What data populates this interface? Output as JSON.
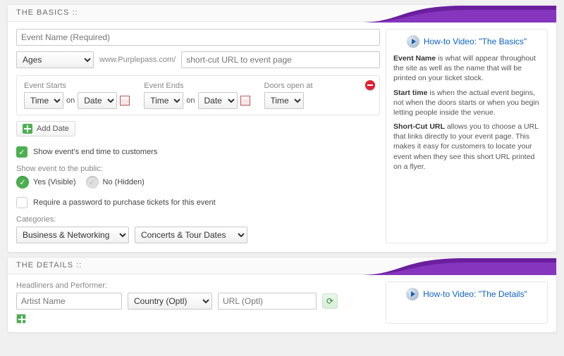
{
  "basics": {
    "header": "THE BASICS ::",
    "event_name_placeholder": "Event Name (Required)",
    "ages_value": "Ages",
    "url_prefix": "www.Purplepass.com/",
    "url_placeholder": "short-cut URL to event page",
    "date_box": {
      "event_starts_label": "Event Starts",
      "event_ends_label": "Event Ends",
      "doors_label": "Doors open at",
      "time_opt": "Time",
      "date_opt": "Date",
      "on_word": "on"
    },
    "add_date_label": "Add Date",
    "show_end_label": "Show event's end time to customers",
    "show_public_label": "Show event to the public:",
    "yes_label": "Yes (Visible)",
    "no_label": "No (Hidden)",
    "password_label": "Require a password to purchase tickets for this event",
    "categories_label": "Categories:",
    "category1": "Business & Networking",
    "category2": "Concerts & Tour Dates",
    "howto_link": "How-to Video: \"The Basics\"",
    "help": {
      "p1_b": "Event Name",
      "p1": " is what will appear throughout the site as well as the name that will be printed on your ticket stock.",
      "p2_b": "Start time",
      "p2": " is when the actual event begins, not when the doors starts or when you begin letting people inside the venue.",
      "p3_b": "Short-Cut URL",
      "p3": " allows you to choose a URL that links directly to your event page. This makes it easy for customers to locate your event when they see this short URL printed on a flyer."
    }
  },
  "details": {
    "header": "THE DETAILS ::",
    "headliners_label": "Headliners and Performer:",
    "artist_placeholder": "Artist Name",
    "country_value": "Country (Optl)",
    "url_placeholder": "URL (Optl)",
    "howto_link": "How-to Video: \"The Details\""
  }
}
